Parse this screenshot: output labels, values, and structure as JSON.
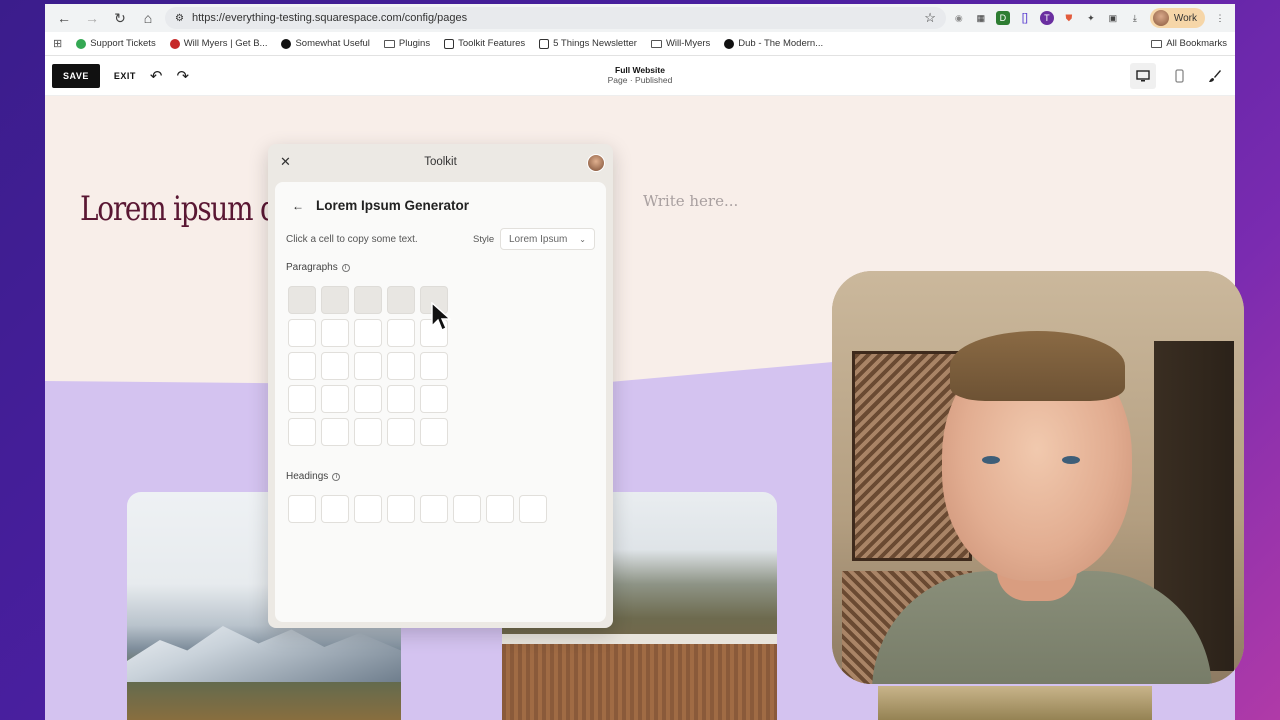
{
  "browser": {
    "url": "https://everything-testing.squarespace.com/config/pages",
    "profile_label": "Work",
    "bookmarks": [
      {
        "label": "Support Tickets",
        "color": "#34a853"
      },
      {
        "label": "Will Myers | Get B...",
        "color": "#c62828"
      },
      {
        "label": "Somewhat Useful",
        "color": "#111111"
      },
      {
        "label": "Plugins",
        "color": "folder"
      },
      {
        "label": "Toolkit Features",
        "color": "notion"
      },
      {
        "label": "5 Things Newsletter",
        "color": "notion"
      },
      {
        "label": "Will-Myers",
        "color": "folder"
      },
      {
        "label": "Dub - The Modern...",
        "color": "#111111"
      }
    ],
    "all_bookmarks_label": "All Bookmarks"
  },
  "editor": {
    "save_label": "SAVE",
    "exit_label": "EXIT",
    "page_title": "Full Website",
    "page_status": "Page · Published"
  },
  "canvas": {
    "hero_heading": "Lorem ipsum do",
    "placeholder": "Write here..."
  },
  "toolkit": {
    "title": "Toolkit",
    "heading": "Lorem Ipsum Generator",
    "hint": "Click a cell to copy some text.",
    "style_label": "Style",
    "style_value": "Lorem Ipsum",
    "paragraphs_label": "Paragraphs",
    "headings_label": "Headings",
    "paragraph_grid": {
      "rows": 5,
      "cols": 5,
      "highlighted_row": 1
    },
    "heading_cells": 8
  },
  "colors": {
    "accent_purple": "#d4c3f0",
    "hero_text": "#5a1733",
    "canvas_bg": "#f8eee9"
  }
}
